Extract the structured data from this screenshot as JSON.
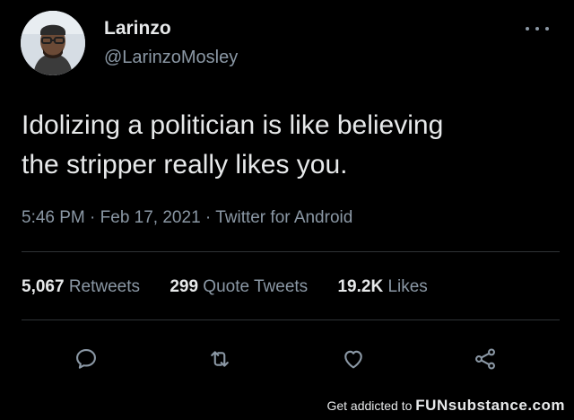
{
  "tweet": {
    "display_name": "Larinzo",
    "handle": "@LarinzoMosley",
    "text_line1": "Idolizing a politician is like believing",
    "text_line2": "the stripper really likes you.",
    "time": "5:46 PM",
    "date": "Feb 17, 2021",
    "source": "Twitter for Android",
    "meta_separator": " · "
  },
  "stats": {
    "retweets_count": "5,067",
    "retweets_label": "Retweets",
    "quotes_count": "299",
    "quotes_label": "Quote Tweets",
    "likes_count": "19.2K",
    "likes_label": "Likes"
  },
  "actions": {
    "reply_icon": "reply-icon",
    "retweet_icon": "retweet-icon",
    "like_icon": "heart-icon",
    "share_icon": "share-icon"
  },
  "footer": {
    "prefix": "Get addicted to",
    "brand": "FUNsubstance.com"
  },
  "colors": {
    "background": "#000000",
    "primary_text": "#e7e9ea",
    "secondary_text": "#8b98a5",
    "divider": "#2f3336"
  }
}
